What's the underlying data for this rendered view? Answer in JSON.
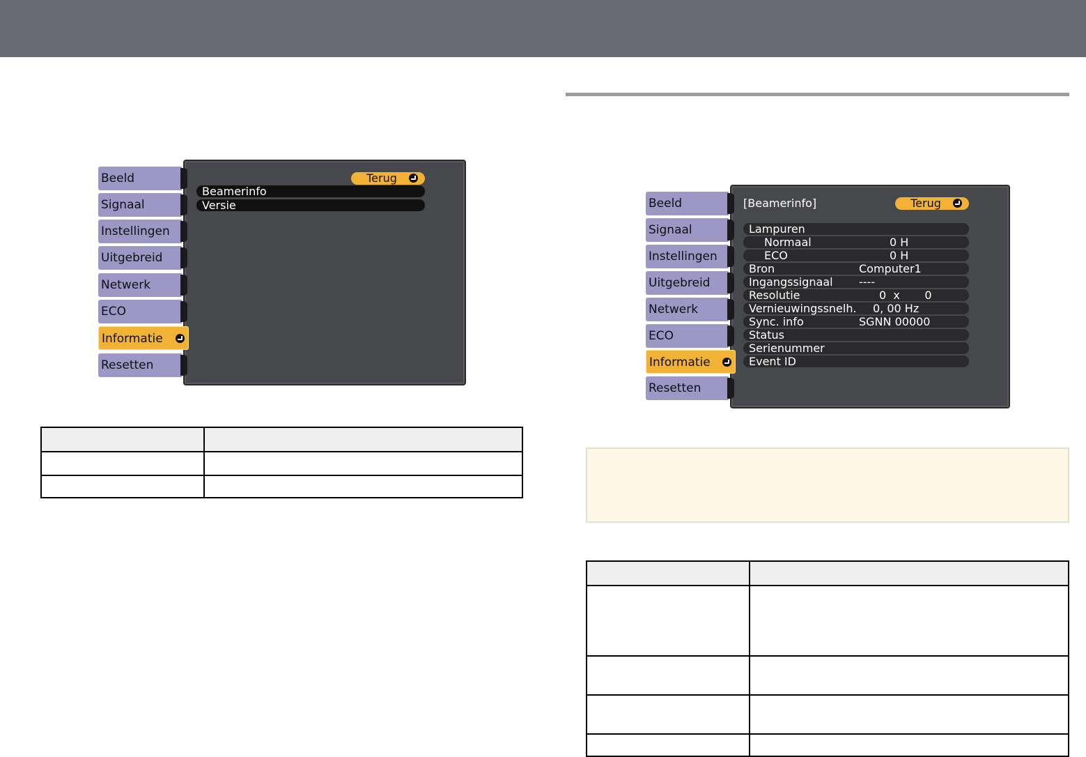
{
  "menu1": {
    "tabs": [
      "Beeld",
      "Signaal",
      "Instellingen",
      "Uitgebreid",
      "Netwerk",
      "ECO",
      "Informatie",
      "Resetten"
    ],
    "active_tab": "Informatie",
    "back_label": "Terug",
    "items": [
      "Beamerinfo",
      "Versie"
    ]
  },
  "menu2": {
    "tabs": [
      "Beeld",
      "Signaal",
      "Instellingen",
      "Uitgebreid",
      "Netwerk",
      "ECO",
      "Informatie",
      "Resetten"
    ],
    "active_tab": "Informatie",
    "title": "[Beamerinfo]",
    "back_label": "Terug",
    "rows": [
      {
        "label": "Lampuren",
        "value": ""
      },
      {
        "label": "Normaal",
        "value": "0  H"
      },
      {
        "label": "ECO",
        "value": "0  H"
      },
      {
        "label": "Bron",
        "value": "Computer1"
      },
      {
        "label": "Ingangssignaal",
        "value": "----"
      },
      {
        "label": "Resolutie",
        "value": "0  x       0"
      },
      {
        "label": "Vernieuwingssnelh.",
        "value": "0, 00 Hz"
      },
      {
        "label": "Sync. info",
        "value": "SGNN 00000"
      },
      {
        "label": "Status",
        "value": ""
      },
      {
        "label": "Serienummer",
        "value": ""
      },
      {
        "label": "Event ID",
        "value": ""
      }
    ]
  },
  "colors": {
    "topbar": "#686b74",
    "tab": "#9d97c6",
    "active_tab": "#f2b236",
    "panel": "#47484b",
    "note_bg": "#fff7e6"
  }
}
